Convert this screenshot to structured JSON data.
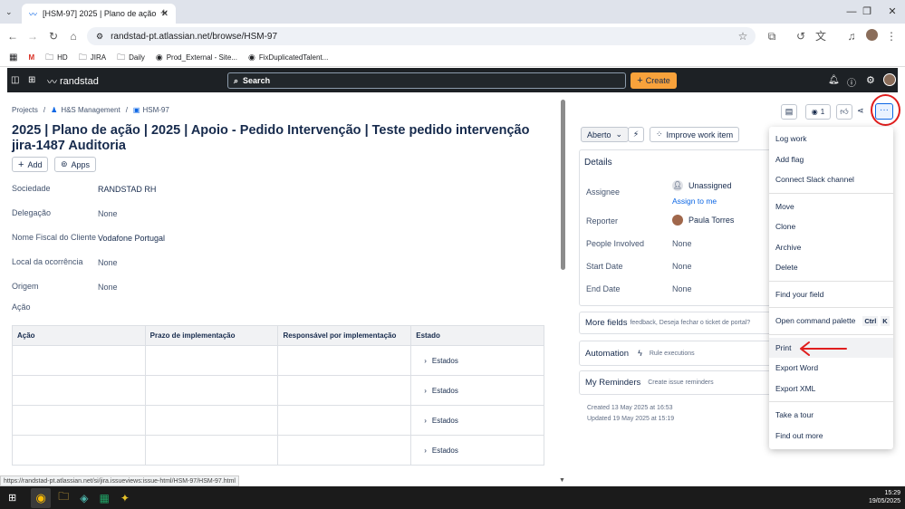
{
  "browser": {
    "tab_title": "[HSM-97] 2025 | Plano de ação",
    "url": "randstad-pt.atlassian.net/browse/HSM-97",
    "bookmarks": [
      "HD",
      "JIRA",
      "Daily",
      "Prod_External - Site...",
      "FixDuplicatedTalent..."
    ],
    "status_url": "https://randstad-pt.atlassian.net/si/jira.issueviews:issue-html/HSM-97/HSM-97.html"
  },
  "jira_nav": {
    "logo": "randstad",
    "search_placeholder": "Search",
    "create_label": "Create"
  },
  "breadcrumb": [
    "Projects",
    "H&S Management",
    "HSM-97"
  ],
  "issue": {
    "title": "2025 | Plano de ação | 2025 | Apoio - Pedido Intervenção | Teste pedido intervenção jira-1487 Auditoria",
    "add_label": "Add",
    "apps_label": "Apps",
    "fields": [
      {
        "label": "Sociedade",
        "value": "RANDSTAD RH"
      },
      {
        "label": "Delegação",
        "value": "None"
      },
      {
        "label": "Nome Fiscal do Cliente",
        "value": "Vodafone Portugal"
      },
      {
        "label": "Local da ocorrência",
        "value": "None"
      },
      {
        "label": "Origem",
        "value": "None"
      }
    ],
    "acao_label": "Ação",
    "table_headers": [
      "Ação",
      "Prazo de implementação",
      "Responsável por implementação",
      "Estado"
    ],
    "table_rows": [
      {
        "estado": "Estados"
      },
      {
        "estado": "Estados"
      },
      {
        "estado": "Estados"
      },
      {
        "estado": "Estados"
      }
    ]
  },
  "right_panel": {
    "status_label": "Aberto",
    "improve_label": "Improve work item",
    "watch_count": "1",
    "details_title": "Details",
    "assignee_label": "Assignee",
    "assignee_value": "Unassigned",
    "assign_to_me": "Assign to me",
    "reporter_label": "Reporter",
    "reporter_value": "Paula Torres",
    "people_label": "People Involved",
    "people_value": "None",
    "start_label": "Start Date",
    "start_value": "None",
    "end_label": "End Date",
    "end_value": "None",
    "more_fields": "More fields",
    "more_fields_sub": "feedback, Deseja fechar o ticket de portal?",
    "automation": "Automation",
    "automation_sub": "Rule executions",
    "reminders": "My Reminders",
    "reminders_sub": "Create issue reminders",
    "created": "Created 13 May 2025 at 16:53",
    "updated": "Updated 19 May 2025 at 15:19"
  },
  "menu": {
    "items": [
      "Log work",
      "Add flag",
      "Connect Slack channel",
      "Move",
      "Clone",
      "Archive",
      "Delete",
      "Find your field",
      "Open command palette",
      "Print",
      "Export Word",
      "Export XML",
      "Take a tour",
      "Find out more"
    ],
    "shortcut_ctrl": "Ctrl",
    "shortcut_k": "K"
  },
  "taskbar": {
    "time": "15:29",
    "date": "19/05/2025"
  },
  "colors": {
    "annotation": "#e01e1e",
    "nav_bg": "#1d2125",
    "create": "#f8a23b",
    "link": "#0c66e4"
  }
}
